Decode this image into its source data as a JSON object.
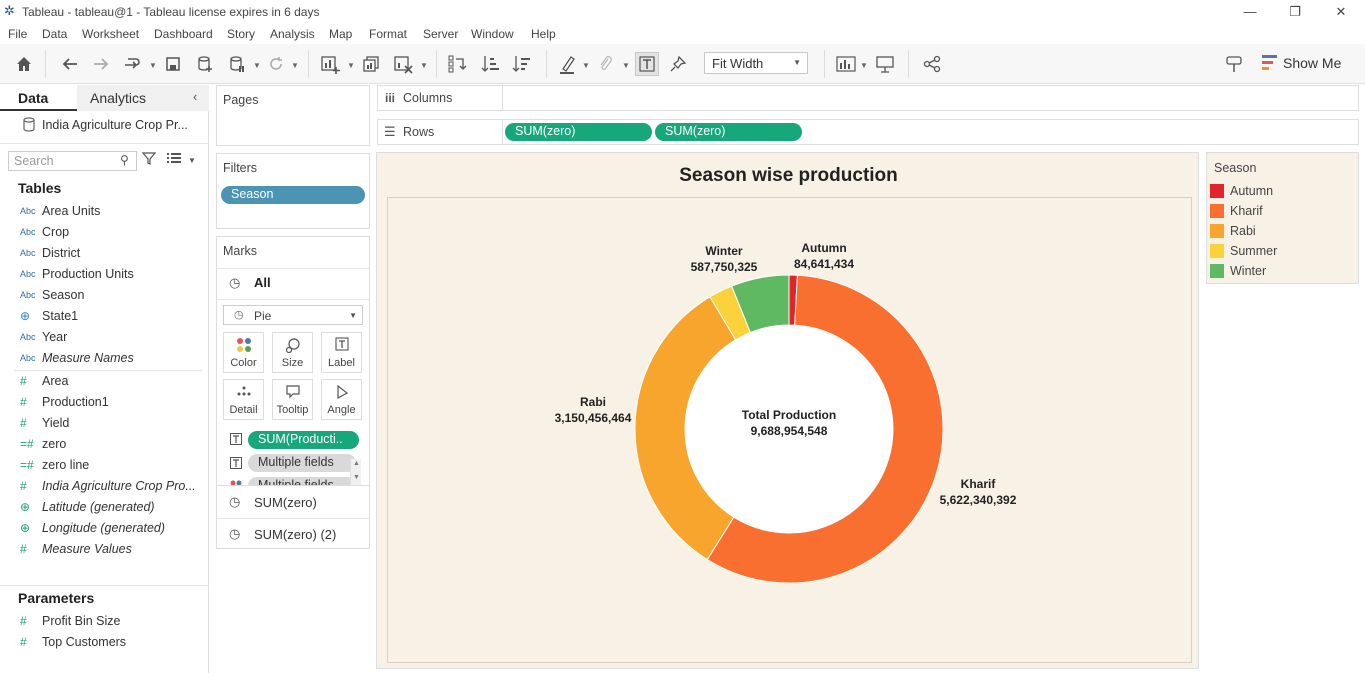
{
  "window": {
    "title": "Tableau - tableau@1 - Tableau license expires in 6 days",
    "minimize_icon": "minimize-icon",
    "restore_icon": "restore-icon",
    "close_icon": "close-icon"
  },
  "menu": [
    "File",
    "Data",
    "Worksheet",
    "Dashboard",
    "Story",
    "Analysis",
    "Map",
    "Format",
    "Server",
    "Window",
    "Help"
  ],
  "toolbar": {
    "fit": "Fit Width",
    "show_me": "Show Me"
  },
  "data_pane": {
    "tabs": [
      "Data",
      "Analytics"
    ],
    "datasource": "India Agriculture Crop Pr...",
    "search_placeholder": "Search",
    "tables_heading": "Tables",
    "dimensions": [
      {
        "type": "Abc",
        "name": "Area Units"
      },
      {
        "type": "Abc",
        "name": "Crop"
      },
      {
        "type": "Abc",
        "name": "District"
      },
      {
        "type": "Abc",
        "name": "Production Units"
      },
      {
        "type": "Abc",
        "name": "Season"
      },
      {
        "type": "geo",
        "name": "State1"
      },
      {
        "type": "Abc",
        "name": "Year"
      },
      {
        "type": "Abc",
        "name": "Measure Names"
      }
    ],
    "measures": [
      {
        "type": "#",
        "name": "Area"
      },
      {
        "type": "#",
        "name": "Production1"
      },
      {
        "type": "#",
        "name": "Yield"
      },
      {
        "type": "=#",
        "name": "zero"
      },
      {
        "type": "=#",
        "name": "zero line"
      },
      {
        "type": "#",
        "name": "India Agriculture Crop Pro..."
      },
      {
        "type": "geo",
        "name": "Latitude (generated)"
      },
      {
        "type": "geo",
        "name": "Longitude (generated)"
      },
      {
        "type": "#",
        "name": "Measure Values"
      }
    ],
    "parameters_heading": "Parameters",
    "parameters": [
      {
        "type": "#",
        "name": "Profit Bin Size"
      },
      {
        "type": "#",
        "name": "Top Customers"
      }
    ]
  },
  "pages": {
    "title": "Pages"
  },
  "filters": {
    "title": "Filters",
    "pill": "Season"
  },
  "marks": {
    "title": "Marks",
    "all": "All",
    "mark_type": "Pie",
    "buttons": [
      "Color",
      "Size",
      "Label",
      "Detail",
      "Tooltip",
      "Angle"
    ],
    "pills": [
      "SUM(Producti..",
      "Multiple fields",
      "Multiple fields"
    ],
    "cards": [
      "SUM(zero)",
      "SUM(zero) (2)"
    ]
  },
  "shelves": {
    "columns": "Columns",
    "rows": "Rows",
    "row_pills": [
      "SUM(zero)",
      "SUM(zero)"
    ]
  },
  "viz": {
    "center_label": "Total Production",
    "center_value": "9,688,954,548"
  },
  "legend": {
    "title": "Season"
  },
  "chart_data": {
    "type": "pie",
    "title": "Season wise production",
    "categories": [
      "Autumn",
      "Kharif",
      "Rabi",
      "Summer",
      "Winter"
    ],
    "values": [
      84641434,
      5622340392,
      3150456464,
      243766000,
      587750325
    ],
    "labels": {
      "Autumn": "84,641,434",
      "Kharif": "5,622,340,392",
      "Rabi": "3,150,456,464",
      "Winter": "587,750,325"
    },
    "colors": {
      "Autumn": "#e2252a",
      "Kharif": "#f96f30",
      "Rabi": "#f7a52c",
      "Summer": "#fcd23b",
      "Winter": "#5fb962"
    },
    "donut": true
  }
}
